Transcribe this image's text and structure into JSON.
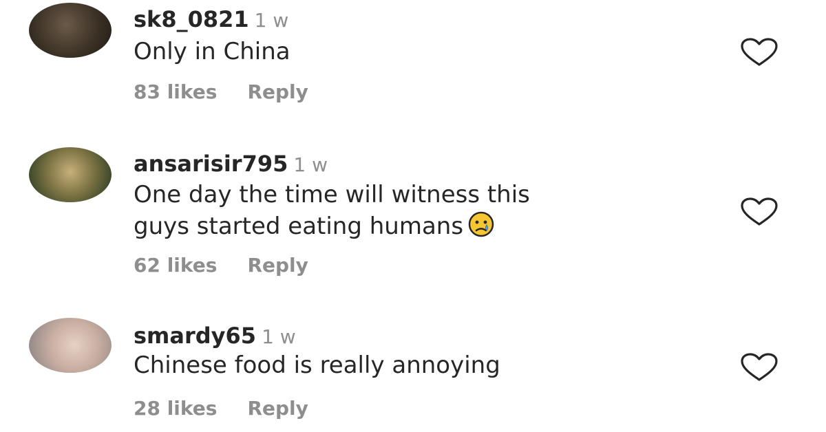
{
  "comments": [
    {
      "username": "sk8_0821",
      "time": "1 w",
      "text_lines": [
        "Only in China"
      ],
      "likes": "83 likes",
      "reply": "Reply",
      "icons": {
        "avatar": "avatar",
        "like": "heart-outline-icon"
      }
    },
    {
      "username": "ansarisir795",
      "time": "1 w",
      "text_lines": [
        "One day the time will witness this",
        "guys started eating humans"
      ],
      "emoji": "crying-face-emoji",
      "likes": "62 likes",
      "reply": "Reply",
      "icons": {
        "avatar": "avatar",
        "like": "heart-outline-icon"
      }
    },
    {
      "username": "smardy65",
      "time": "1 w",
      "text_lines": [
        "Chinese food is really annoying"
      ],
      "likes": "28 likes",
      "reply": "Reply",
      "icons": {
        "avatar": "avatar",
        "like": "heart-outline-icon"
      }
    }
  ],
  "colors": {
    "text": "#262626",
    "muted": "#8e8e8e",
    "background": "#ffffff"
  }
}
